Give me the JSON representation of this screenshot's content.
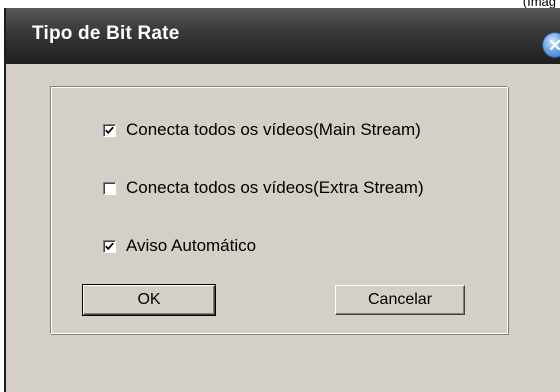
{
  "top_strip": {
    "partial_text": "(Imag"
  },
  "dialog": {
    "title": "Tipo de Bit Rate",
    "close_icon": "close-icon",
    "checkboxes": [
      {
        "label": "Conecta todos os vídeos(Main Stream)",
        "checked": true
      },
      {
        "label": "Conecta todos os vídeos(Extra Stream)",
        "checked": false
      },
      {
        "label": "Aviso Automático",
        "checked": true
      }
    ],
    "buttons": {
      "ok_label": "OK",
      "cancel_label": "Cancelar"
    }
  },
  "colors": {
    "dialog_bg": "#d4d0c8",
    "titlebar_dark": "#1e1e1e",
    "title_text": "#ffffff",
    "close_blue": "#2f68bf"
  }
}
